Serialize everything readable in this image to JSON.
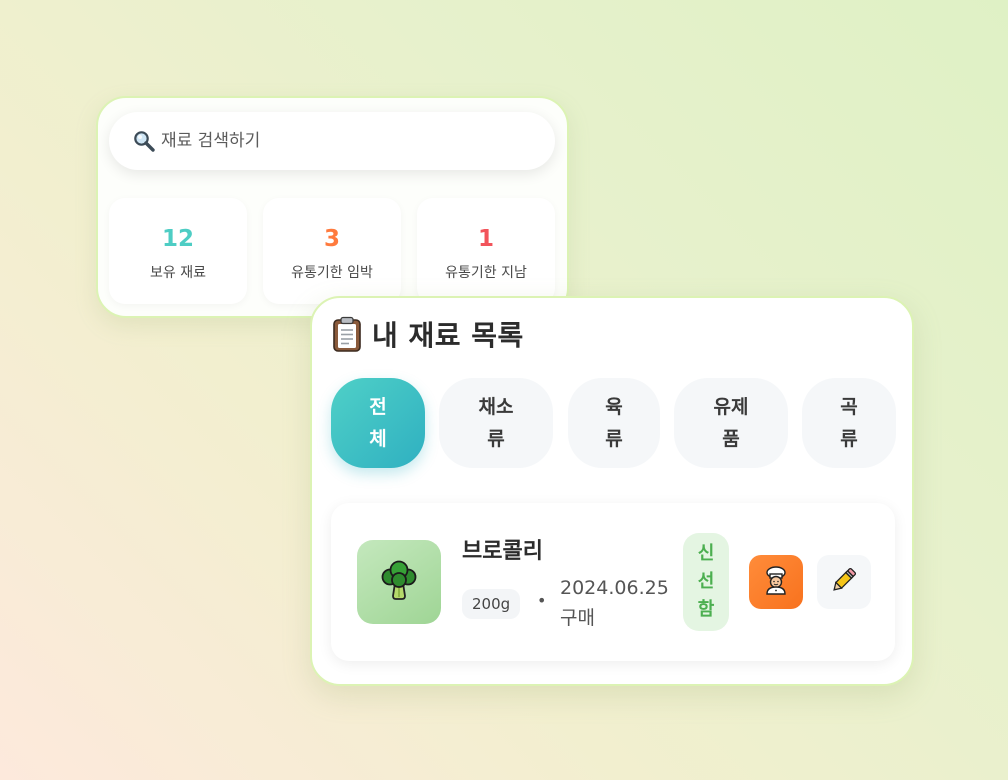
{
  "search": {
    "placeholder": "재료 검색하기"
  },
  "stats": [
    {
      "value": "12",
      "label": "보유 재료",
      "color": "#4ecdc4"
    },
    {
      "value": "3",
      "label": "유통기한 임박",
      "color": "#ff7a3d"
    },
    {
      "value": "1",
      "label": "유통기한 지남",
      "color": "#f2545b"
    }
  ],
  "list": {
    "title": "내 재료 목록",
    "icon": "clipboard-icon",
    "tabs": [
      {
        "lines": [
          "전",
          "체"
        ],
        "active": true
      },
      {
        "lines": [
          "채소",
          "류"
        ],
        "active": false
      },
      {
        "lines": [
          "육",
          "류"
        ],
        "active": false
      },
      {
        "lines": [
          "유제",
          "품"
        ],
        "active": false
      },
      {
        "lines": [
          "곡",
          "류"
        ],
        "active": false
      }
    ],
    "items": [
      {
        "name": "브로콜리",
        "icon": "broccoli-icon",
        "quantity": "200g",
        "separator": "•",
        "date": "2024.06.25",
        "date_suffix": "구매",
        "status_lines": [
          "신",
          "선",
          "함"
        ],
        "actions": [
          "cook-icon",
          "pencil-icon"
        ]
      }
    ]
  },
  "colors": {
    "accent_teal": "#3cc0c4",
    "fresh_green": "#4caf50",
    "cook_orange": "#fa7a28",
    "card_border": "#dcf3b4"
  }
}
